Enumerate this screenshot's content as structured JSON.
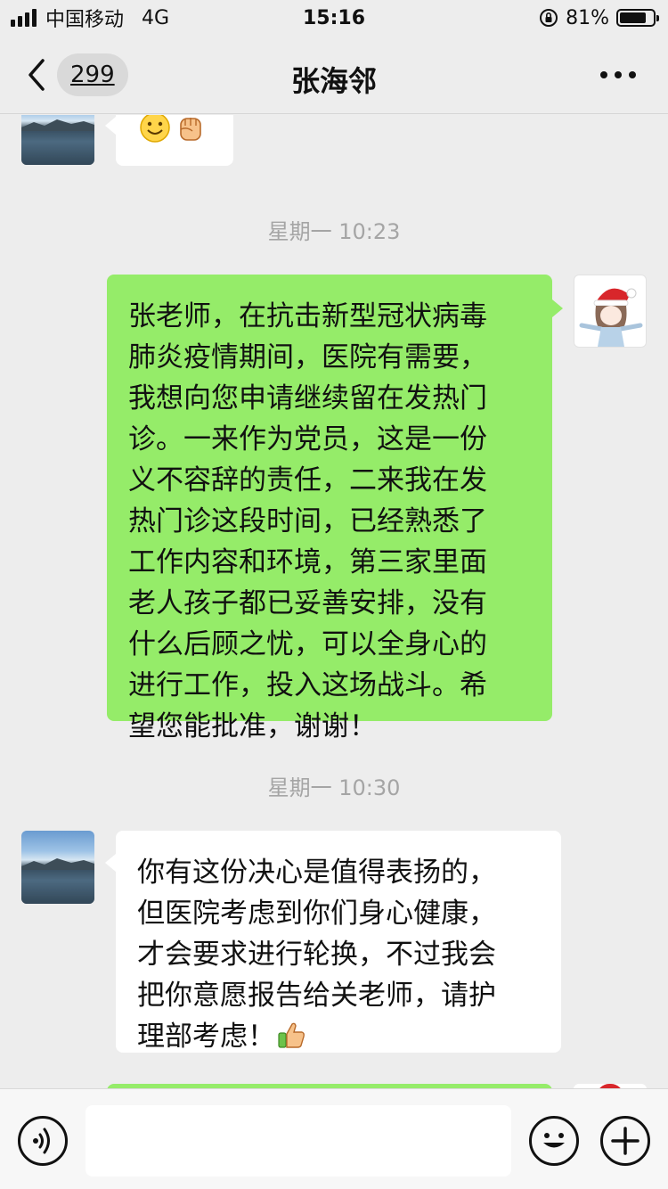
{
  "status_bar": {
    "carrier": "中国移动",
    "network": "4G",
    "time": "15:16",
    "battery_percent": "81%",
    "battery_level": 0.81
  },
  "nav": {
    "unread_count": "299",
    "title": "张海邻"
  },
  "messages": [
    {
      "side": "left",
      "avatar": "lake-landscape-avatar",
      "emojis": [
        "smiling-face-emoji",
        "raised-fist-emoji"
      ]
    },
    {
      "timestamp": "星期一 10:23"
    },
    {
      "side": "right",
      "avatar": "christmas-hat-girl-avatar",
      "lines": [
        "张老师，在抗击新型冠状病毒",
        "肺炎疫情期间，医院有需要，",
        "我想向您申请继续留在发热门",
        "诊。一来作为党员，这是一份",
        "义不容辞的责任，二来我在发",
        "热门诊这段时间，已经熟悉了",
        "工作内容和环境，第三家里面",
        "老人孩子都已妥善安排，没有",
        "什么后顾之忧，可以全身心的",
        "进行工作，投入这场战斗。希",
        "望您能批准，谢谢！"
      ]
    },
    {
      "timestamp": "星期一 10:30"
    },
    {
      "side": "left",
      "avatar": "lake-landscape-avatar",
      "lines": [
        "你有这份决心是值得表扬的，",
        "但医院考虑到你们身心健康，",
        "才会要求进行轮换，不过我会",
        "把你意愿报告给关老师，请护",
        "理部考虑！"
      ],
      "trailing_emoji": "thumbs-up-emoji"
    }
  ],
  "input_bar": {
    "value": "",
    "placeholder": ""
  },
  "colors": {
    "background": "#ededed",
    "self_bubble": "#95ec69",
    "other_bubble": "#ffffff",
    "timestamp": "#a5a5a5"
  }
}
